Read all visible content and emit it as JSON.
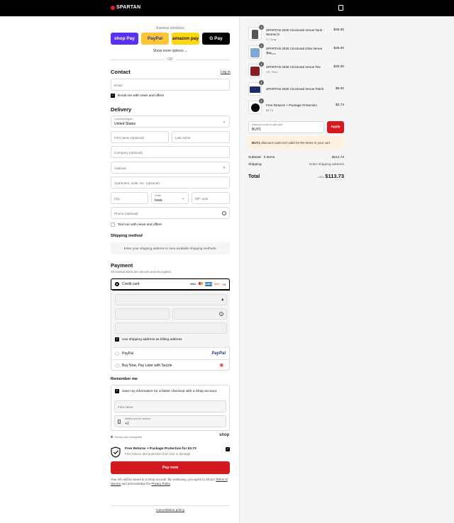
{
  "header": {
    "brand": "SPARTAN"
  },
  "express": {
    "title": "Express checkout",
    "buttons": [
      {
        "label": "shop Pay",
        "bg": "#5a31f4",
        "fg": "#ffffff"
      },
      {
        "label": "PayPal",
        "bg": "#ffc439",
        "fg": "#253b80"
      },
      {
        "label": "amazon pay",
        "bg": "#ffd814",
        "fg": "#111111"
      },
      {
        "label": "G Pay",
        "bg": "#000000",
        "fg": "#ffffff"
      }
    ],
    "more": "Show more options",
    "or": "OR"
  },
  "contact": {
    "title": "Contact",
    "login": "Log in",
    "email_placeholder": "Email",
    "news": "Email me with news and offers"
  },
  "delivery": {
    "title": "Delivery",
    "country_label": "Country/Region",
    "country_value": "United States",
    "first_name": "First name (optional)",
    "last_name": "Last name",
    "company": "Company (optional)",
    "address": "Address",
    "apartment": "Apartment, suite, etc. (optional)",
    "city": "City",
    "state_label": "State",
    "state_value": "Iowa",
    "zip": "ZIP code",
    "phone": "Phone (optional)",
    "text_news": "Text me with news and offers"
  },
  "shipping": {
    "title": "Shipping method",
    "message": "Enter your shipping address to view available shipping methods."
  },
  "payment": {
    "title": "Payment",
    "subtitle": "All transactions are secure and encrypted.",
    "credit_card": "Credit card",
    "more_cards": "+4",
    "billing_same": "Use shipping address as billing address",
    "paypal": "PayPal",
    "paypal_logo": "PayPal",
    "sezzle": "Buy Now, Pay Later with Sezzle"
  },
  "remember": {
    "title": "Remember me",
    "save": "Save my information for a faster checkout with a Shop account",
    "first_name": "First name",
    "mobile_label": "Mobile phone number",
    "mobile_value": "+1",
    "secure": "Secure and encrypted",
    "shop": "shop"
  },
  "protection": {
    "title": "Free Returns + Package Protection for $3.73",
    "desc": "Free returns and protection from loss or damage."
  },
  "pay_now": "Pay now",
  "legal": {
    "text1": "Your info will be saved to a Shop account. By continuing, you agree to Shop's",
    "terms": "Terms of Service",
    "text2": "and acknowledge the",
    "privacy": "Privacy Policy",
    "end": "."
  },
  "cancellation": "Cancellation policy",
  "cart": {
    "items": [
      {
        "qty": "1",
        "name": "SPARTAN 2025 Cincinnati Venue Tank - Women's",
        "variant": "S / Gray",
        "price": "$35.00",
        "color": "#555555"
      },
      {
        "qty": "1",
        "name": "SPARTAN 2025 Cincinnati Ultra Venue Tee",
        "variant": "S / Blue",
        "price": "$35.00",
        "color": "#7fa8d6"
      },
      {
        "qty": "1",
        "name": "SPARTAN 2025 Cincinnati Venue Tee",
        "variant": "XS / Red",
        "price": "$35.00",
        "color": "#8b1a22"
      },
      {
        "qty": "1",
        "name": "SPARTAN 2025 Cincinnati Venue Patch",
        "variant": "",
        "price": "$5.00",
        "color": "#1f2a6b"
      },
      {
        "qty": "1",
        "name": "Free Returns + Package Protection",
        "variant": "$3.73",
        "price": "$3.73",
        "color": "#000000"
      }
    ],
    "discount_label": "Discount code or gift card",
    "discount_value": "BUY1",
    "apply": "Apply",
    "error_code": "BUY1",
    "error_text": "discount code isn't valid for the items in your cart",
    "subtotal_label": "Subtotal · 5 items",
    "subtotal_value": "$113.73",
    "shipping_label": "Shipping",
    "shipping_value": "Enter shipping address",
    "total_label": "Total",
    "currency": "USD",
    "total_value": "$113.73"
  }
}
